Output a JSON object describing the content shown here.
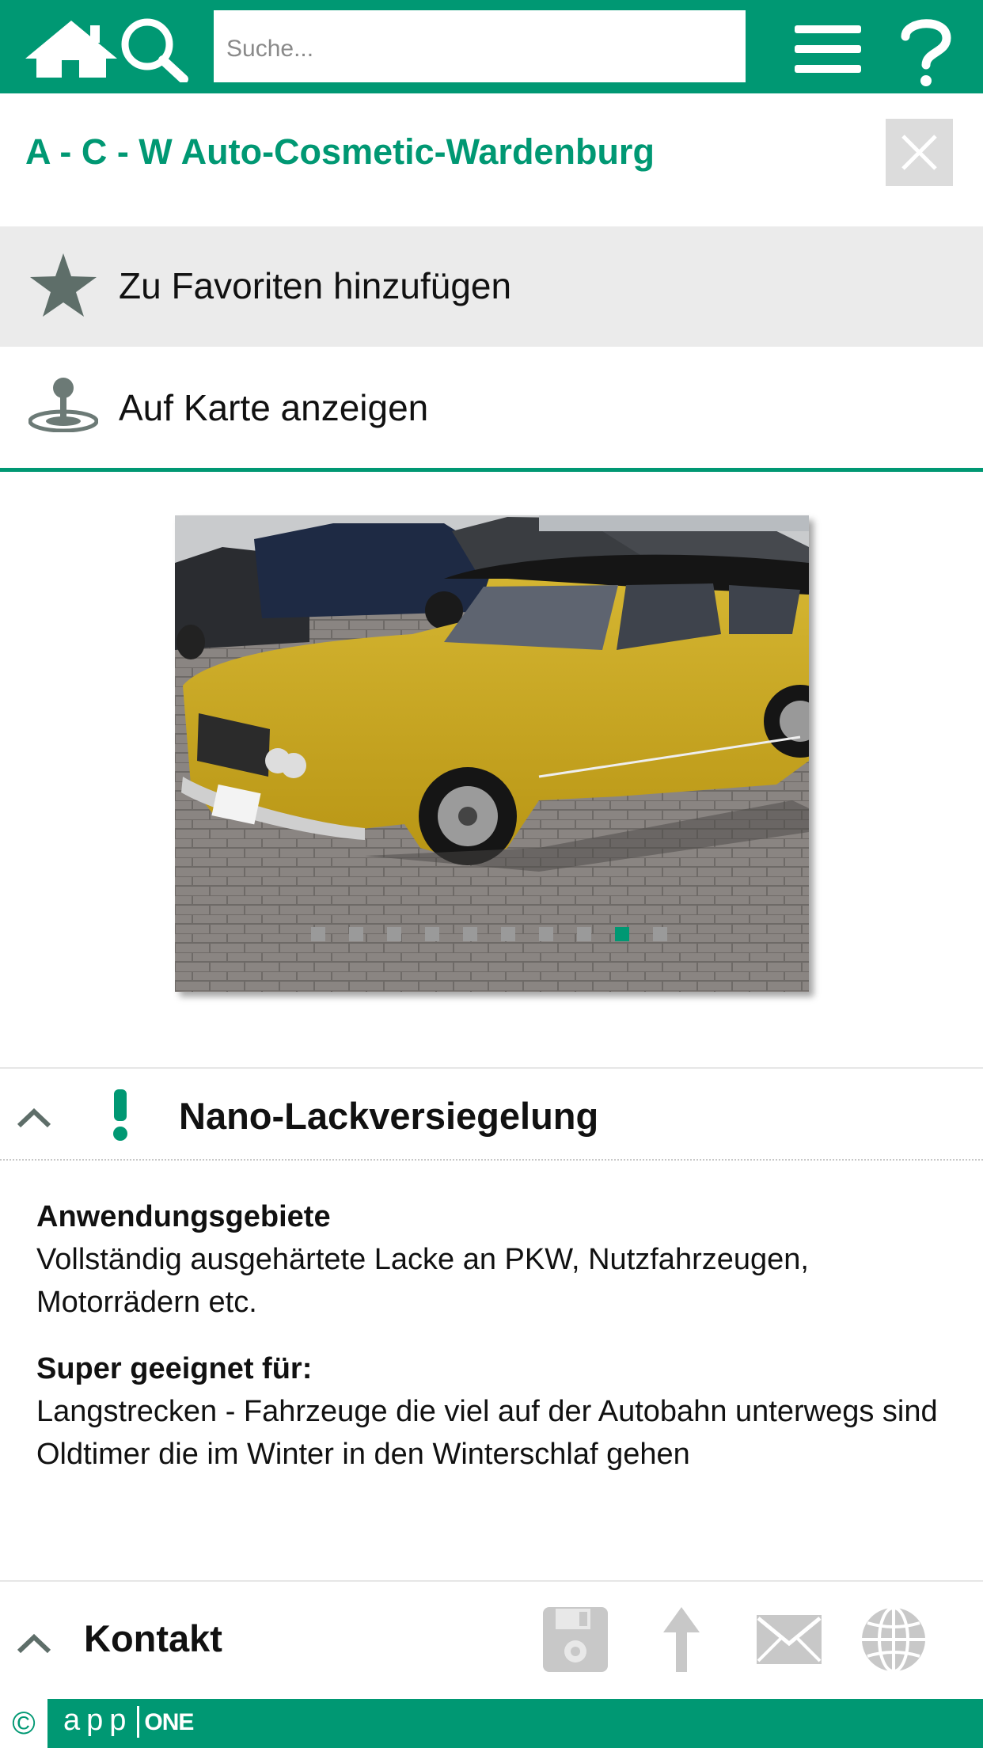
{
  "topbar": {
    "search_placeholder": "Suche...",
    "icons": [
      "home-icon",
      "search-icon",
      "menu-icon",
      "help-icon"
    ],
    "color": "#009873"
  },
  "header": {
    "title": "A - C - W Auto-Cosmetic-Wardenburg"
  },
  "actions": {
    "favorites_label": "Zu Favoriten hinzufügen",
    "map_label": "Auf Karte anzeigen"
  },
  "gallery": {
    "image_count": 10,
    "active_index": 8
  },
  "section": {
    "title": "Nano-Lackversiegelung",
    "blocks": [
      {
        "heading": "Anwendungsgebiete",
        "lines": [
          "Vollständig ausgehärtete Lacke an PKW, Nutzfahrzeugen, Motorrädern etc."
        ]
      },
      {
        "heading": "Super geeignet für:",
        "lines": [
          "Langstrecken - Fahrzeuge die viel auf der Autobahn unterwegs sind",
          "Oldtimer die im Winter in den Winterschlaf gehen"
        ]
      }
    ]
  },
  "contact": {
    "title": "Kontakt",
    "icons": [
      "save-icon",
      "share-icon",
      "mail-icon",
      "web-icon"
    ]
  },
  "footer": {
    "copyright": "©",
    "brand_left": "app",
    "brand_right": "ONE"
  }
}
